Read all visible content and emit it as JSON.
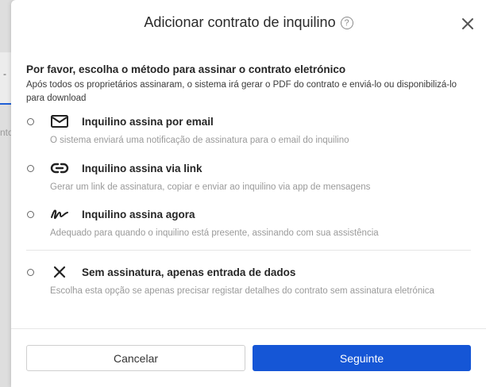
{
  "background": {
    "dash": "-",
    "ghost_text": "nto"
  },
  "modal": {
    "title": "Adicionar contrato de inquilino",
    "help_icon": "?",
    "close_icon": "close-icon"
  },
  "intro": {
    "title": "Por favor, escolha o método para assinar o contrato eletrónico",
    "description": "Após todos os proprietários assinaram, o sistema irá gerar o PDF do contrato e enviá-lo ou disponibilizá-lo para download"
  },
  "options": [
    {
      "label": "Inquilino assina por email",
      "description": "O sistema enviará uma notificação de assinatura para o email do inquilino",
      "icon": "envelope-icon",
      "selected": false
    },
    {
      "label": "Inquilino assina via link",
      "description": "Gerar um link de assinatura, copiar e enviar ao inquilino via app de mensagens",
      "icon": "link-icon",
      "selected": false
    },
    {
      "label": "Inquilino assina agora",
      "description": "Adequado para quando o inquilino está presente, assinando com sua assistência",
      "icon": "signature-icon",
      "selected": false
    },
    {
      "label": "Sem assinatura, apenas entrada de dados",
      "description": "Escolha esta opção se apenas precisar registar detalhes do contrato sem assinatura eletrónica",
      "icon": "x-icon",
      "selected": false
    }
  ],
  "footer": {
    "cancel_label": "Cancelar",
    "next_label": "Seguinte"
  },
  "colors": {
    "primary": "#1556d6",
    "muted_text": "#9a9a9a"
  }
}
